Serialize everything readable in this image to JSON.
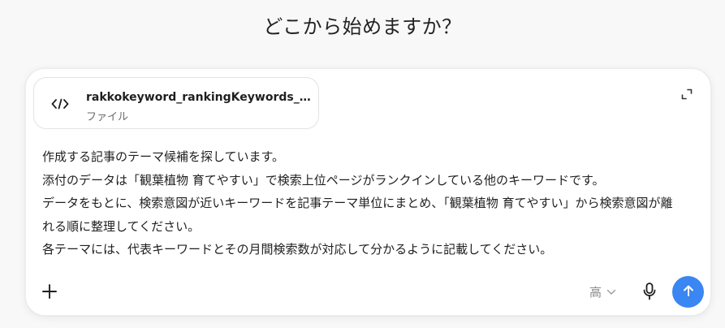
{
  "heading": "どこから始めますか？",
  "attachment": {
    "name": "rakkokeyword_rankingKeywords_観葉...",
    "type": "ファイル",
    "icon": "code-file-icon"
  },
  "message": {
    "lines": [
      "作成する記事のテーマ候補を探しています。",
      "添付のデータは「観葉植物 育てやすい」で検索上位ページがランクインしている他のキーワードです。",
      "データをもとに、検索意図が近いキーワードを記事テーマ単位にまとめ、「観葉植物 育てやすい」から検索意図が離",
      "れる順に整理してください。",
      "各テーマには、代表キーワードとその月間検索数が対応して分かるように記載してください。"
    ]
  },
  "toolbar": {
    "add_icon": "plus-icon",
    "model_label": "高",
    "mic_icon": "microphone-icon",
    "send_icon": "arrow-up-icon",
    "expand_icon": "expand-icon"
  },
  "colors": {
    "send_button": "#3a86f2",
    "background": "#f8f8f8",
    "composer": "#ffffff"
  }
}
